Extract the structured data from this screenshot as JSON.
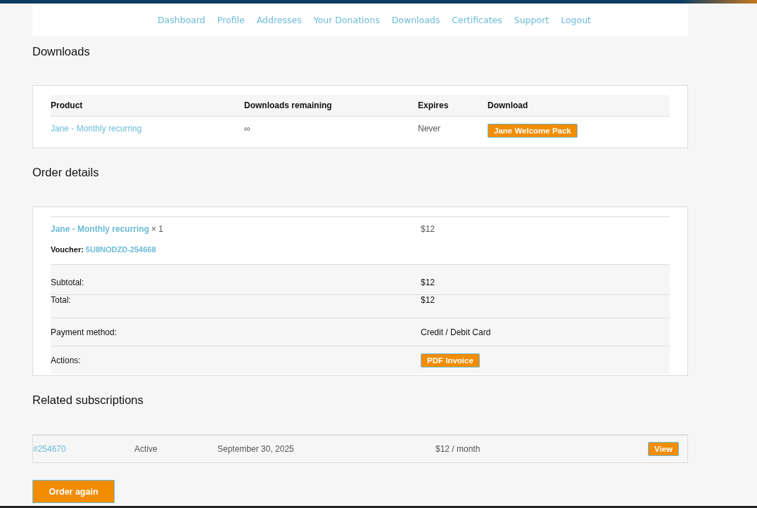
{
  "nav": [
    "Dashboard",
    "Profile",
    "Addresses",
    "Your Donations",
    "Downloads",
    "Certificates",
    "Support",
    "Logout"
  ],
  "downloads": {
    "title": "Downloads",
    "columns": [
      "Product",
      "Downloads remaining",
      "Expires",
      "Download"
    ],
    "rows": [
      {
        "product": "Jane - Monthly recurring",
        "remaining": "∞",
        "expires": "Never",
        "download": "Jane Welcome Pack"
      }
    ]
  },
  "order_details": {
    "title": "Order details",
    "item": {
      "product": "Jane - Monthly recurring",
      "quantity": "× 1",
      "total": "$12",
      "voucher_label": "Voucher:",
      "voucher_code": "5U8NODZD-254668"
    },
    "totals": [
      {
        "kind": "text",
        "label": "Subtotal:",
        "value": "$12"
      },
      {
        "kind": "text",
        "label": "Total:",
        "value": "$12"
      },
      {
        "kind": "text",
        "label": "Payment method:",
        "value": "Credit / Debit Card"
      },
      {
        "kind": "button",
        "label": "Actions:",
        "value": "PDF Invoice"
      }
    ]
  },
  "related": {
    "title": "Related subscriptions",
    "rows": [
      {
        "id": "#254670",
        "status": "Active",
        "date": "September 30, 2025",
        "total": "$12 / month",
        "action": "View"
      }
    ]
  },
  "order_again": "Order again"
}
